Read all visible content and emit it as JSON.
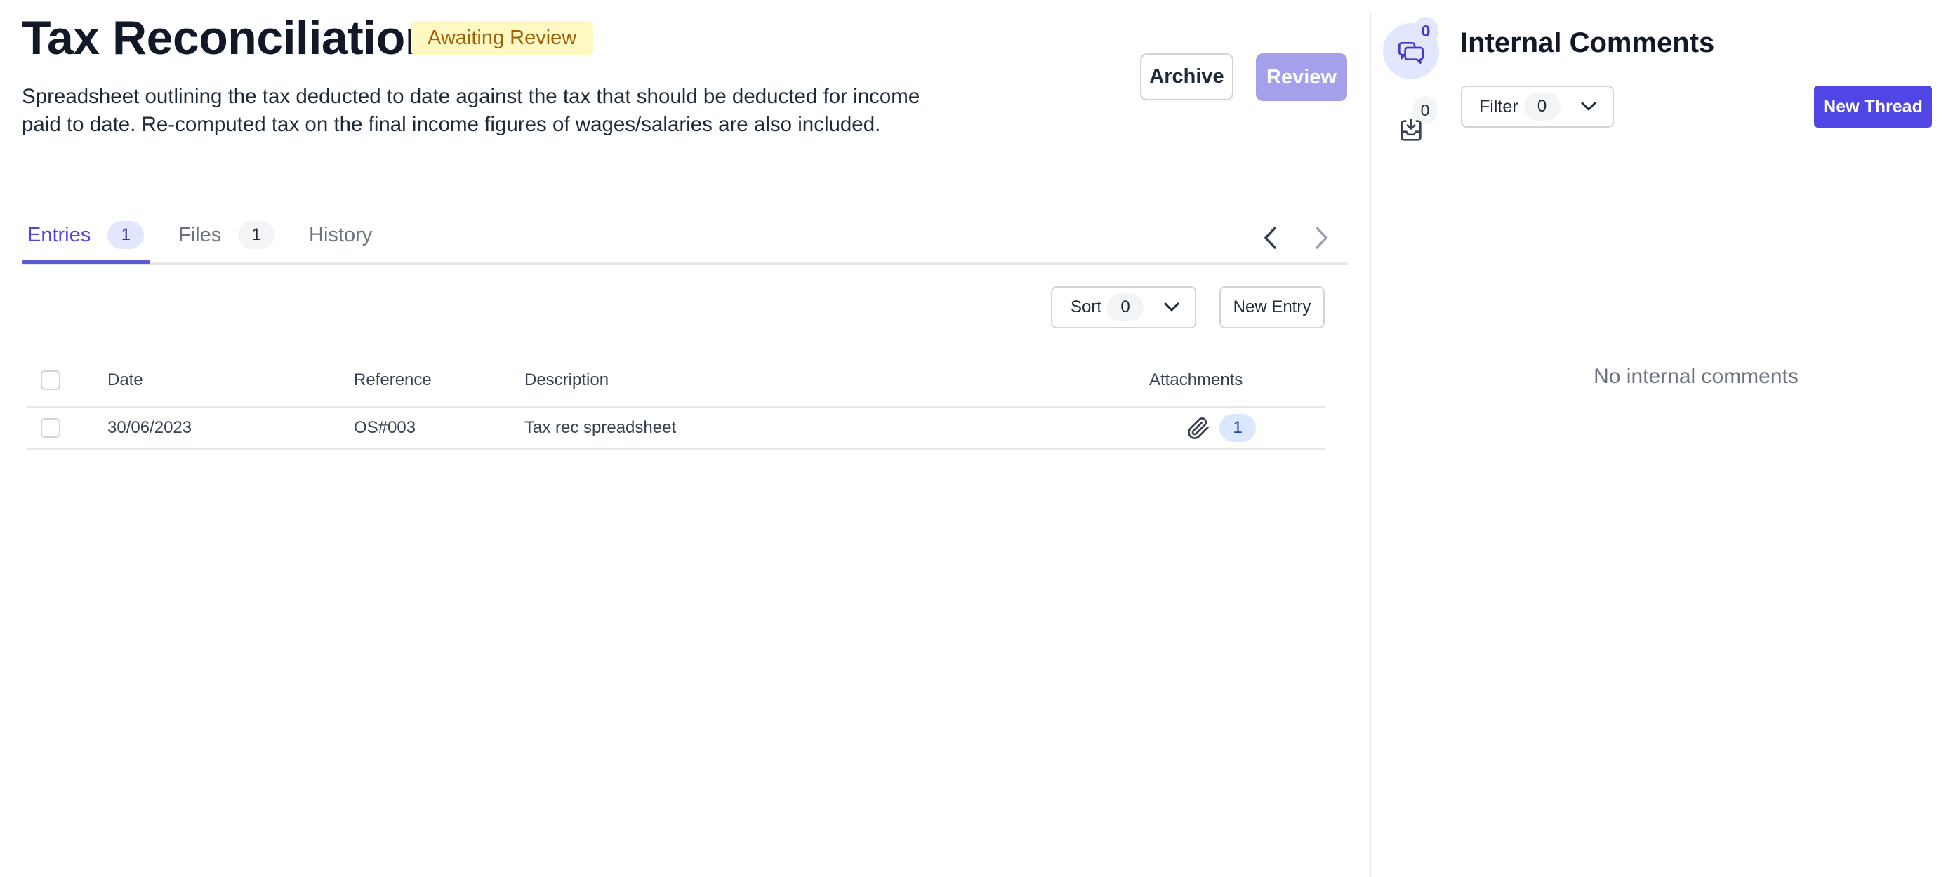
{
  "header": {
    "title": "Tax Reconciliation",
    "status_badge": "Awaiting Review",
    "description": "Spreadsheet outlining the tax deducted to date against the tax that should be deducted for income paid to date. Re-computed tax on the final income figures of wages/salaries are also included.",
    "archive_label": "Archive",
    "review_label": "Review"
  },
  "tabs": [
    {
      "label": "Entries",
      "count": "1",
      "active": true
    },
    {
      "label": "Files",
      "count": "1",
      "active": false
    },
    {
      "label": "History",
      "active": false
    }
  ],
  "pager": {
    "prev_icon": "chevron-left-icon",
    "next_icon": "chevron-right-icon"
  },
  "toolbar": {
    "sort_label": "Sort",
    "sort_count": "0",
    "new_entry_label": "New Entry"
  },
  "table": {
    "columns": [
      "Date",
      "Reference",
      "Description",
      "Attachments"
    ],
    "rows": [
      {
        "date": "30/06/2023",
        "reference": "OS#003",
        "description": "Tax rec spreadsheet",
        "attachments": "1"
      }
    ]
  },
  "comments_panel": {
    "title": "Internal Comments",
    "comment_count": "0",
    "inbox_count": "0",
    "filter_label": "Filter",
    "filter_count": "0",
    "new_thread_label": "New Thread",
    "empty_message": "No internal comments"
  },
  "colors": {
    "accent": "#4f46e5",
    "review_disabled": "#a5a0ec",
    "badge_bg": "#fef9c3",
    "badge_text": "#a16207"
  }
}
